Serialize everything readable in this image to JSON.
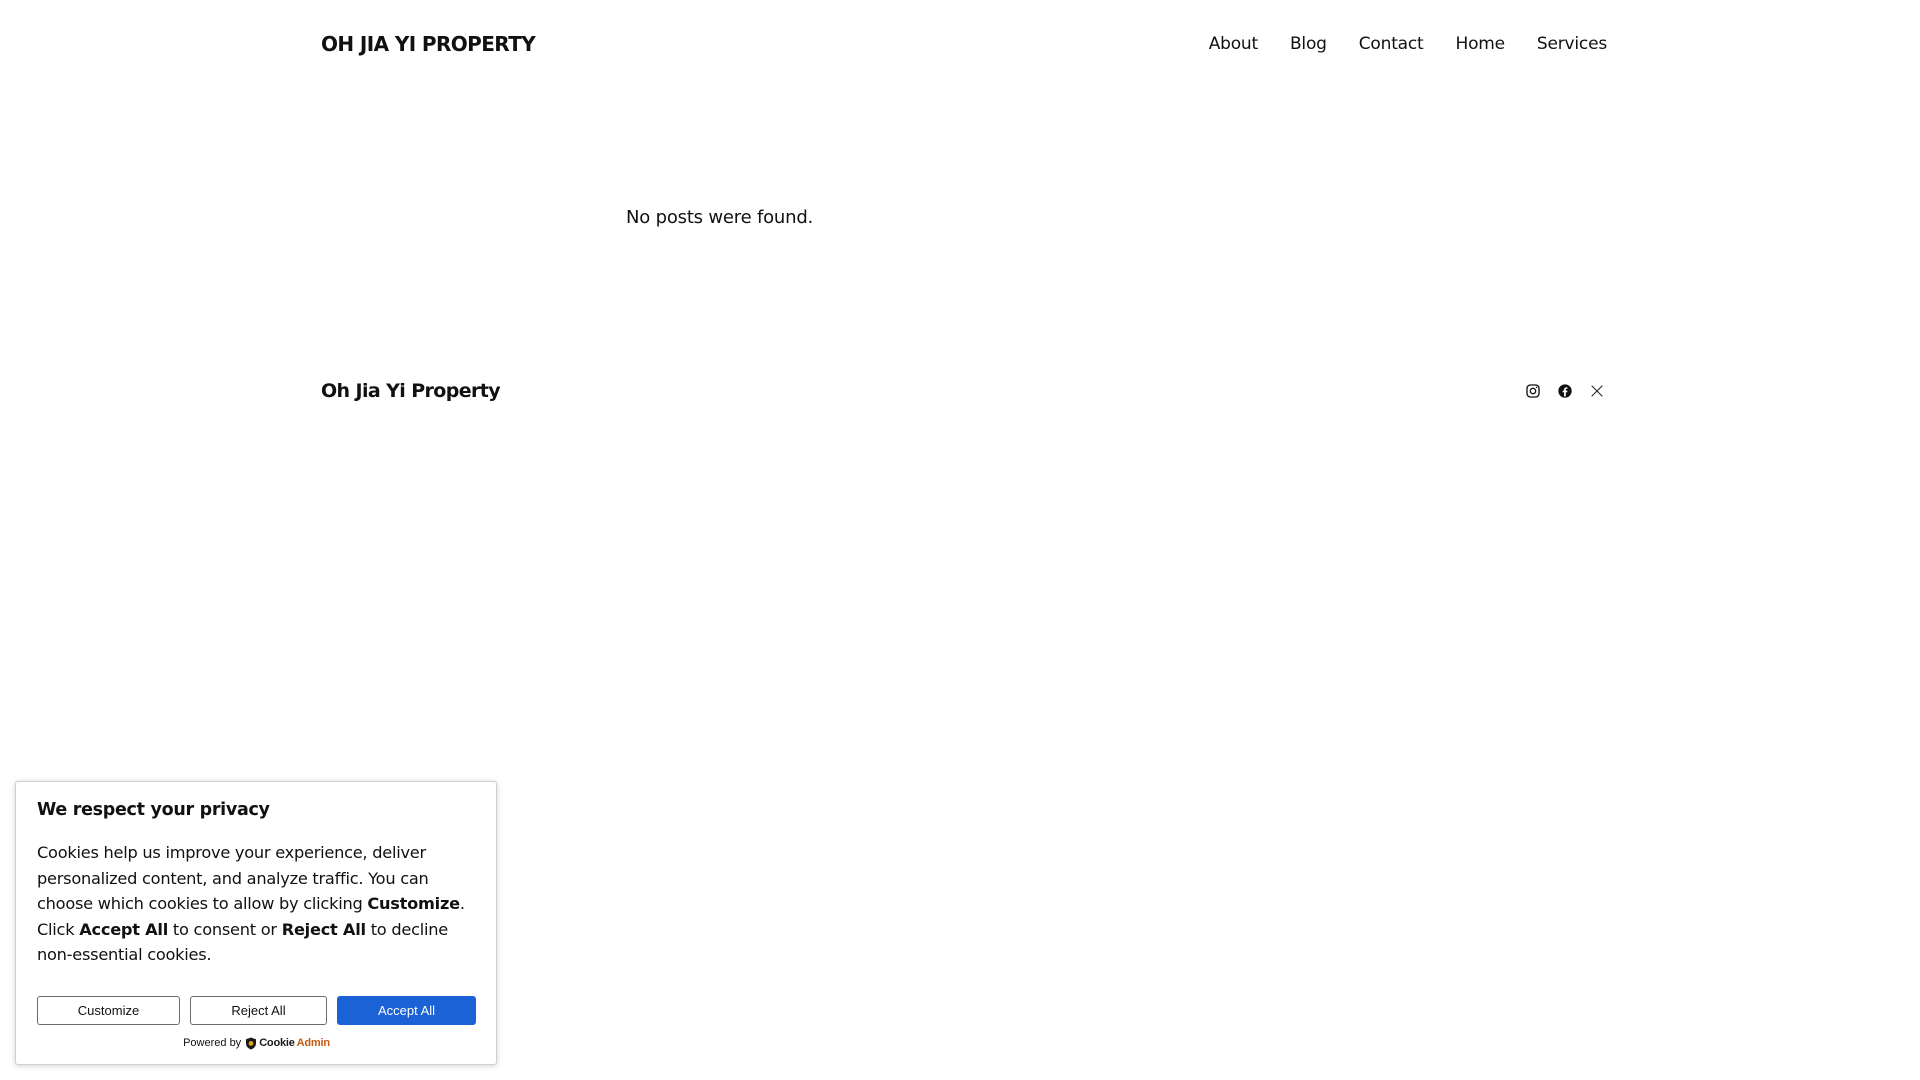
{
  "header": {
    "site_title": "OH JIA YI PROPERTY",
    "nav": [
      {
        "label": "About"
      },
      {
        "label": "Blog"
      },
      {
        "label": "Contact"
      },
      {
        "label": "Home"
      },
      {
        "label": "Services"
      }
    ]
  },
  "main": {
    "message": "No posts were found."
  },
  "footer": {
    "site_title": "Oh Jia Yi Property",
    "social": [
      {
        "icon": "instagram-icon"
      },
      {
        "icon": "facebook-icon"
      },
      {
        "icon": "x-icon"
      }
    ]
  },
  "cookie_banner": {
    "title": "We respect your privacy",
    "text_1": "Cookies help us improve your experience, deliver personalized content, and analyze traffic. You can choose which cookies to allow by clicking ",
    "bold_customize": "Customize",
    "text_2": ". Click ",
    "bold_accept": "Accept All",
    "text_3": " to consent or ",
    "bold_reject": "Reject All",
    "text_4": " to decline non-essential cookies.",
    "buttons": {
      "customize": "Customize",
      "reject": "Reject All",
      "accept": "Accept All"
    },
    "powered_by": "Powered by",
    "brand_part1": "Cookie",
    "brand_part2": "Admin",
    "colors": {
      "accept_button": "#1a62d6",
      "brand_admin": "#c25a10"
    }
  }
}
